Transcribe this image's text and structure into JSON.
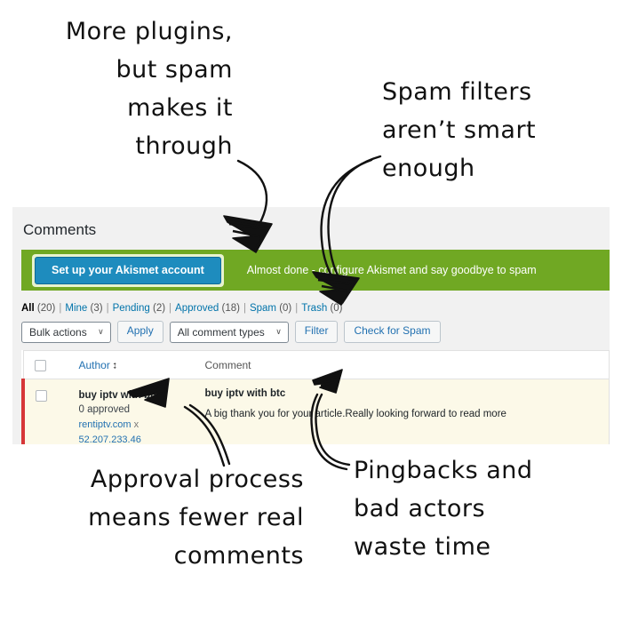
{
  "annotations": [
    {
      "id": "top-left",
      "text": "More plugins,\nbut spam\nmakes it\nthrough"
    },
    {
      "id": "top-right",
      "text": "Spam filters\naren’t smart\nenough"
    },
    {
      "id": "bottom-left",
      "text": "Approval process\nmeans fewer real\ncomments"
    },
    {
      "id": "bottom-right",
      "text": "Pingbacks and\nbad actors\nwaste time"
    }
  ],
  "screenshot": {
    "page_title": "Comments",
    "akismet_notice": {
      "button_label": "Set up your Akismet account",
      "message": "Almost done - configure Akismet and say goodbye to spam",
      "banner_color": "#70a823",
      "button_color": "#1e8cbe"
    },
    "status_filters": [
      {
        "label": "All",
        "count": "(20)",
        "current": true
      },
      {
        "label": "Mine",
        "count": "(3)",
        "current": false
      },
      {
        "label": "Pending",
        "count": "(2)",
        "current": false
      },
      {
        "label": "Approved",
        "count": "(18)",
        "current": false
      },
      {
        "label": "Spam",
        "count": "(0)",
        "current": false
      },
      {
        "label": "Trash",
        "count": "(0)",
        "current": false
      }
    ],
    "separator": "|",
    "toolbar": {
      "bulk_actions_value": "Bulk actions",
      "apply_label": "Apply",
      "comment_types_value": "All comment types",
      "filter_label": "Filter",
      "check_spam_label": "Check for Spam",
      "chevron": "∨"
    },
    "table": {
      "headers": {
        "author": "Author",
        "comment": "Comment",
        "sort_glyph": "⭥"
      },
      "rows": [
        {
          "author_name": "buy iptv with btc",
          "approved_text": "0 approved",
          "site": "rentiptv.com",
          "site_remove": "x",
          "ip": "52.207.233.46",
          "comment_author": "buy iptv with btc",
          "comment_text": "A big thank you for your article.Really looking forward to read more",
          "pending_marker_color": "#d63638",
          "row_bg": "#fcf9e8"
        }
      ]
    }
  }
}
